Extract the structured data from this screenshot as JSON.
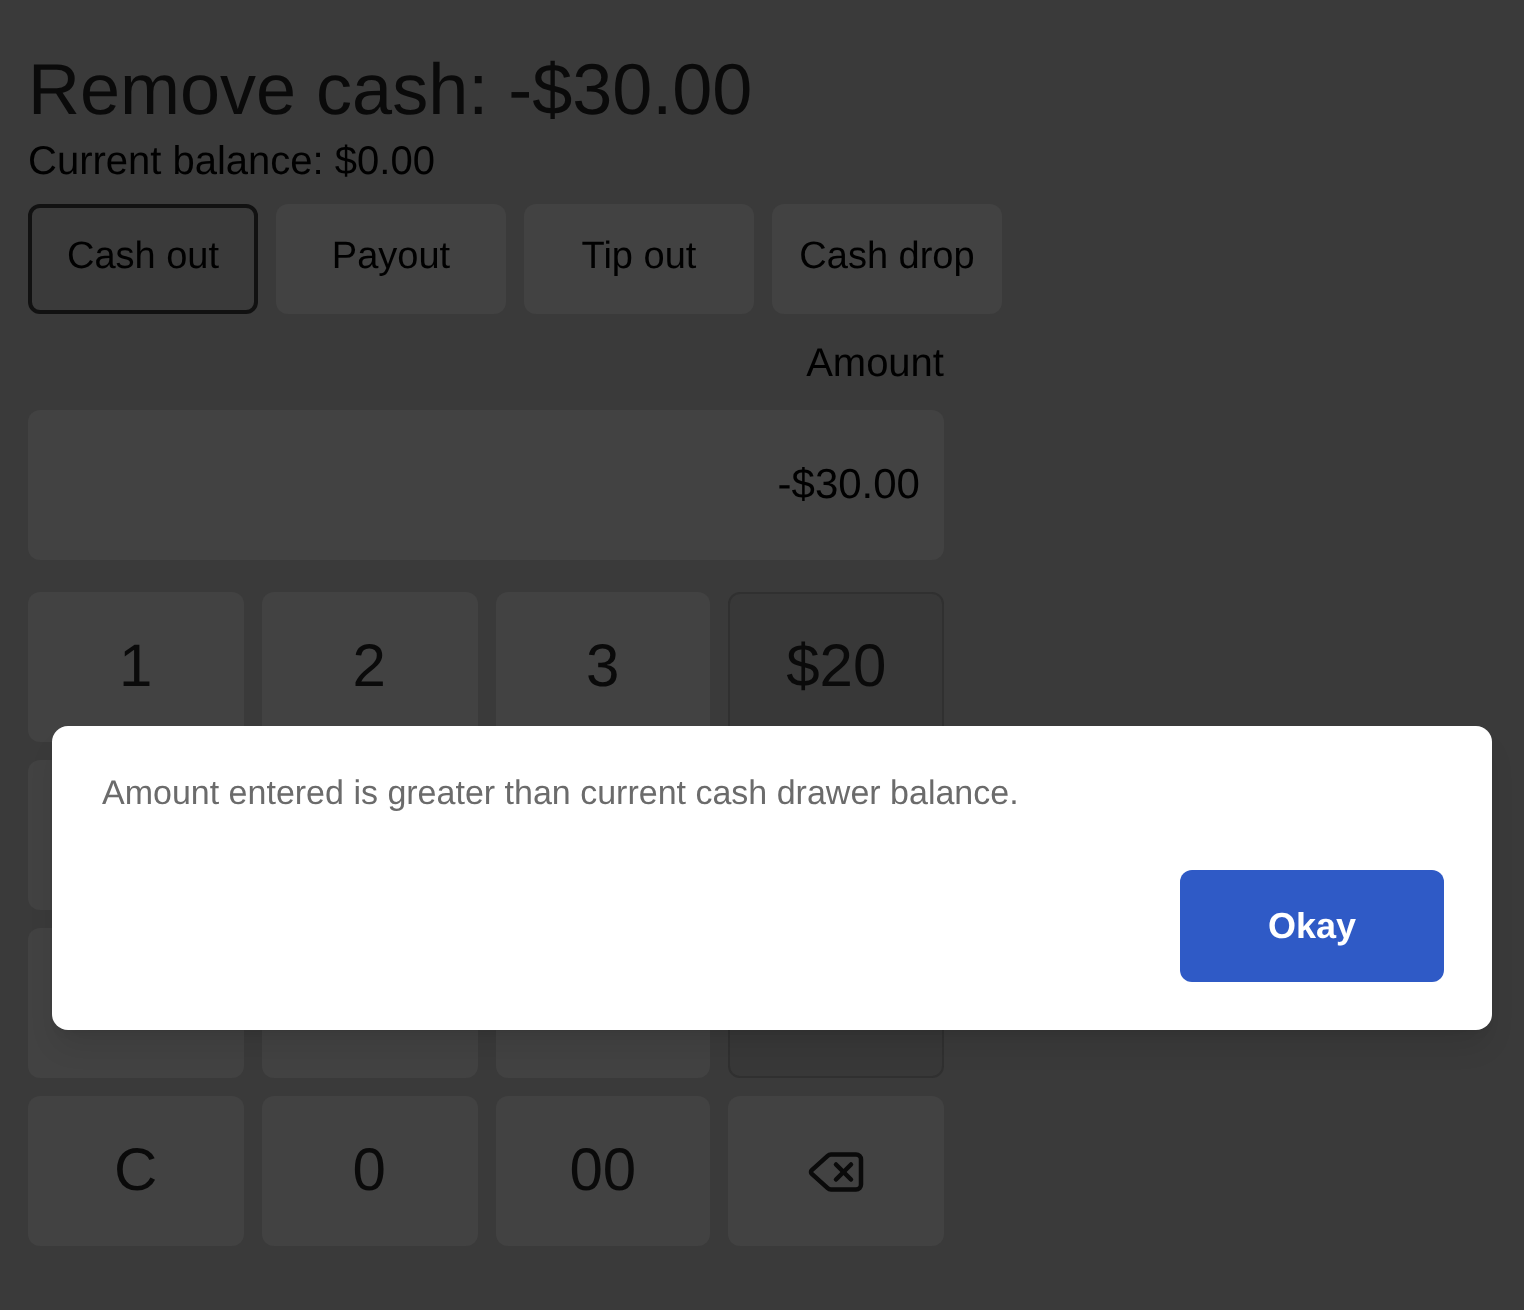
{
  "title": "Remove cash: -$30.00",
  "balance": "Current balance: $0.00",
  "tabs": [
    {
      "label": "Cash out",
      "selected": true
    },
    {
      "label": "Payout",
      "selected": false
    },
    {
      "label": "Tip out",
      "selected": false
    },
    {
      "label": "Cash drop",
      "selected": false
    }
  ],
  "amount": {
    "label": "Amount",
    "value": "-$30.00"
  },
  "keypad": [
    [
      {
        "kind": "digit",
        "label": "1"
      },
      {
        "kind": "digit",
        "label": "2"
      },
      {
        "kind": "digit",
        "label": "3"
      },
      {
        "kind": "preset",
        "label": "$20"
      }
    ],
    [
      {
        "kind": "digit"
      }
    ],
    [
      {
        "kind": "digit"
      },
      {
        "kind": "digit"
      },
      {
        "kind": "digit"
      },
      {
        "kind": "preset"
      }
    ],
    [
      {
        "kind": "digit",
        "label": "C"
      },
      {
        "kind": "digit",
        "label": "0"
      },
      {
        "kind": "digit",
        "label": "00"
      },
      {
        "kind": "backspace"
      }
    ]
  ],
  "dialog": {
    "message": "Amount entered is greater than current cash drawer balance.",
    "button": "Okay"
  }
}
